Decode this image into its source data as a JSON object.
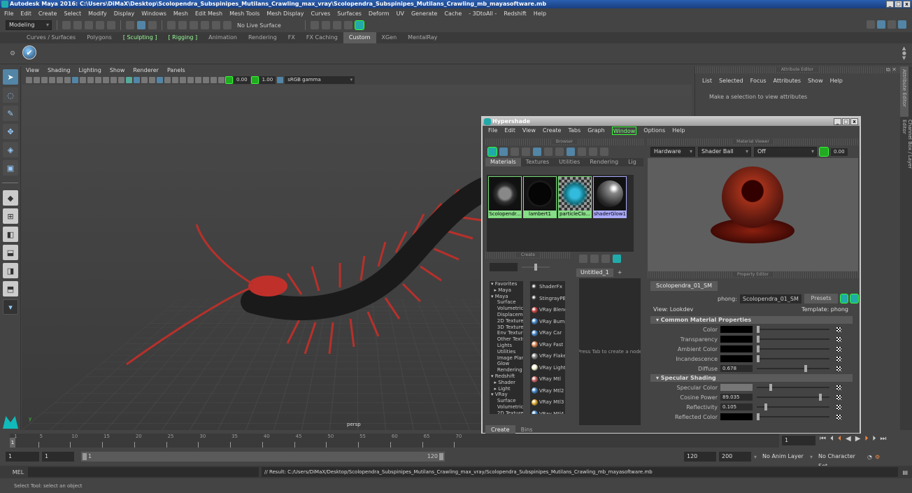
{
  "window": {
    "title": "Autodesk Maya 2016: C:\\Users\\DiMaX\\Desktop\\Scolopendra_Subspinipes_Mutilans_Crawling_max_vray\\Scolopendra_Subspinipes_Mutilans_Crawling_mb_mayasoftware.mb",
    "controls": [
      "_",
      "□",
      "x"
    ]
  },
  "menubar": [
    "File",
    "Edit",
    "Create",
    "Select",
    "Modify",
    "Display",
    "Windows",
    "Mesh",
    "Edit Mesh",
    "Mesh Tools",
    "Mesh Display",
    "Curves",
    "Surfaces",
    "Deform",
    "UV",
    "Generate",
    "Cache",
    "- 3DtoAll -",
    "Redshift",
    "Help"
  ],
  "status_line": {
    "mode": "Modeling",
    "live_surface": "No Live Surface"
  },
  "shelf_tabs": [
    {
      "label": "Curves / Surfaces",
      "active": false
    },
    {
      "label": "Polygons",
      "active": false
    },
    {
      "label": "Sculpting",
      "active": false,
      "bracketed": true
    },
    {
      "label": "Rigging",
      "active": false,
      "bracketed": true
    },
    {
      "label": "Animation",
      "active": false
    },
    {
      "label": "Rendering",
      "active": false
    },
    {
      "label": "FX",
      "active": false
    },
    {
      "label": "FX Caching",
      "active": false
    },
    {
      "label": "Custom",
      "active": true
    },
    {
      "label": "XGen",
      "active": false
    },
    {
      "label": "MentalRay",
      "active": false
    }
  ],
  "viewport": {
    "menu": [
      "View",
      "Shading",
      "Lighting",
      "Show",
      "Renderer",
      "Panels"
    ],
    "exposure": "0.00",
    "gamma": "1.00",
    "color_space": "sRGB gamma",
    "camera_label": "persp"
  },
  "attribute_editor": {
    "header": "Attribute Editor",
    "menu": [
      "List",
      "Selected",
      "Focus",
      "Attributes",
      "Show",
      "Help"
    ],
    "message": "Make a selection to view attributes"
  },
  "side_tabs": [
    "Attribute Editor",
    "Channel Box / Layer Editor"
  ],
  "hypershade": {
    "title": "Hypershade",
    "menu": [
      "File",
      "Edit",
      "View",
      "Create",
      "Tabs",
      "Graph",
      "Window",
      "Options",
      "Help"
    ],
    "browser": {
      "header": "Browser",
      "tabs": [
        "Materials",
        "Textures",
        "Utilities",
        "Rendering",
        "Lig"
      ],
      "materials": [
        {
          "name": "Scolopendr...",
          "selected": false
        },
        {
          "name": "lambert1",
          "selected": false
        },
        {
          "name": "particleClo...",
          "selected": false
        },
        {
          "name": "shaderGlow1",
          "selected": true
        }
      ]
    },
    "material_viewer": {
      "header": "Material Viewer",
      "renderer": "Hardware",
      "shape": "Shader Ball",
      "env": "Off",
      "exposure": "0.00"
    },
    "create": {
      "header": "Create",
      "tree": [
        "▾ Favorites",
        "  ▸ Maya",
        "▾ Maya",
        "    Surface",
        "    Volumetric",
        "    Displacement",
        "    2D Textures",
        "    3D Textures",
        "    Env Textures",
        "    Other Textures",
        "    Lights",
        "    Utilities",
        "    Image Planes",
        "    Glow",
        "    Rendering",
        "▾ Redshift",
        "  ▸ Shader",
        "  ▸ Light",
        "▾ VRay",
        "    Surface",
        "    Volumetric",
        "    2D Textures"
      ],
      "nodes": [
        {
          "label": "ShaderFx",
          "color": "#333"
        },
        {
          "label": "StingrayPBS",
          "color": "#333"
        },
        {
          "label": "VRay Blend",
          "color": "#c44"
        },
        {
          "label": "VRay Bump",
          "color": "#48c"
        },
        {
          "label": "VRay Car",
          "color": "#48c"
        },
        {
          "label": "VRay Fast",
          "color": "#d85"
        },
        {
          "label": "VRay Flakes",
          "color": "#888"
        },
        {
          "label": "VRay Light",
          "color": "#ffd"
        },
        {
          "label": "VRay Mtl",
          "color": "#c66"
        },
        {
          "label": "VRay Mtl2",
          "color": "#48c"
        },
        {
          "label": "VRay Mtl3",
          "color": "#da3"
        },
        {
          "label": "VRay Mtl4",
          "color": "#48c"
        }
      ],
      "bottom_tabs": [
        "Create",
        "Bins"
      ]
    },
    "node_editor": {
      "tabs": [
        "Untitled_1",
        "+"
      ],
      "hint": "Press Tab to create a node"
    },
    "property_editor": {
      "header": "Property Editor",
      "tab": "Scolopendra_01_SM",
      "type_label": "phong:",
      "node_name": "Scolopendra_01_SM",
      "presets": "Presets",
      "view": "View: Lookdev",
      "template": "Template: phong",
      "sections": [
        {
          "title": "Common Material Properties",
          "rows": [
            {
              "label": "Color",
              "kind": "color",
              "color": "#000000",
              "slider": 0.0
            },
            {
              "label": "Transparency",
              "kind": "color",
              "color": "#000000",
              "slider": 0.0
            },
            {
              "label": "Ambient Color",
              "kind": "color",
              "color": "#000000",
              "slider": 0.0
            },
            {
              "label": "Incandescence",
              "kind": "color",
              "color": "#000000",
              "slider": 0.0
            },
            {
              "label": "Diffuse",
              "kind": "num",
              "value": "0.678",
              "slider": 0.678
            }
          ]
        },
        {
          "title": "Specular Shading",
          "rows": [
            {
              "label": "Specular Color",
              "kind": "color",
              "color": "#777777",
              "slider": 0.18
            },
            {
              "label": "Cosine Power",
              "kind": "num",
              "value": "89.035",
              "slider": 0.89
            },
            {
              "label": "Reflectivity",
              "kind": "num",
              "value": "0.105",
              "slider": 0.105
            },
            {
              "label": "Reflected Color",
              "kind": "color",
              "color": "#000000",
              "slider": 0.0
            }
          ]
        }
      ]
    }
  },
  "timeline": {
    "ticks": [
      1,
      5,
      10,
      15,
      20,
      25,
      30,
      35,
      40,
      45,
      50,
      55,
      60,
      65,
      70
    ],
    "current_frame": "1",
    "frame_field": "1"
  },
  "range": {
    "start": "1",
    "anim_start": "1",
    "slider_start": "1",
    "slider_end": "120",
    "end": "120",
    "anim_end": "200",
    "anim_layer": "No Anim Layer",
    "character_set": "No Character Set"
  },
  "command": {
    "label": "MEL",
    "result": "// Result: C:/Users/DiMaX/Desktop/Scolopendra_Subspinipes_Mutilans_Crawling_max_vray/Scolopendra_Subspinipes_Mutilans_Crawling_mb_mayasoftware.mb"
  },
  "help_line": "Select Tool: select an object"
}
